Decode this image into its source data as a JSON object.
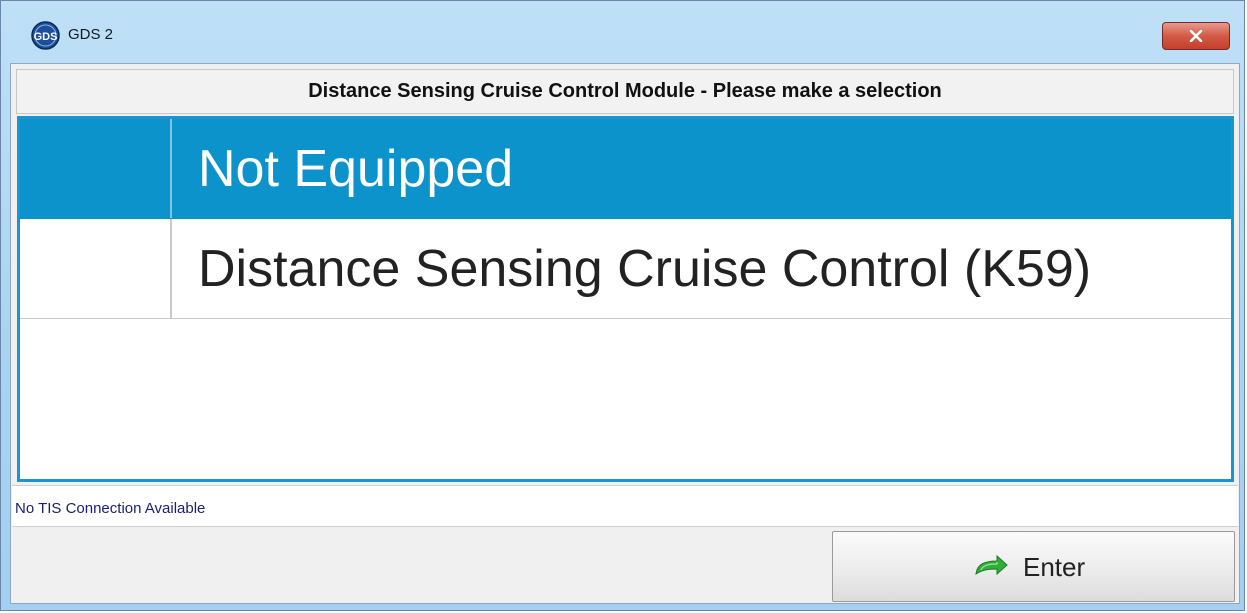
{
  "window": {
    "title": "GDS 2",
    "app_icon_text": "GDS",
    "close_icon": "close-icon"
  },
  "dialog": {
    "header": "Distance Sensing Cruise Control Module - Please make a selection",
    "options": [
      {
        "label": "Not Equipped",
        "selected": true
      },
      {
        "label": "Distance Sensing Cruise Control (K59)",
        "selected": false
      }
    ],
    "status": "No TIS Connection Available",
    "enter_label": "Enter",
    "enter_icon": "green-arrow-icon"
  },
  "colors": {
    "selection": "#0d93cc",
    "panel_border": "#1b95cf",
    "close_button": "#d35a45",
    "status_text": "#1a1f6e"
  }
}
